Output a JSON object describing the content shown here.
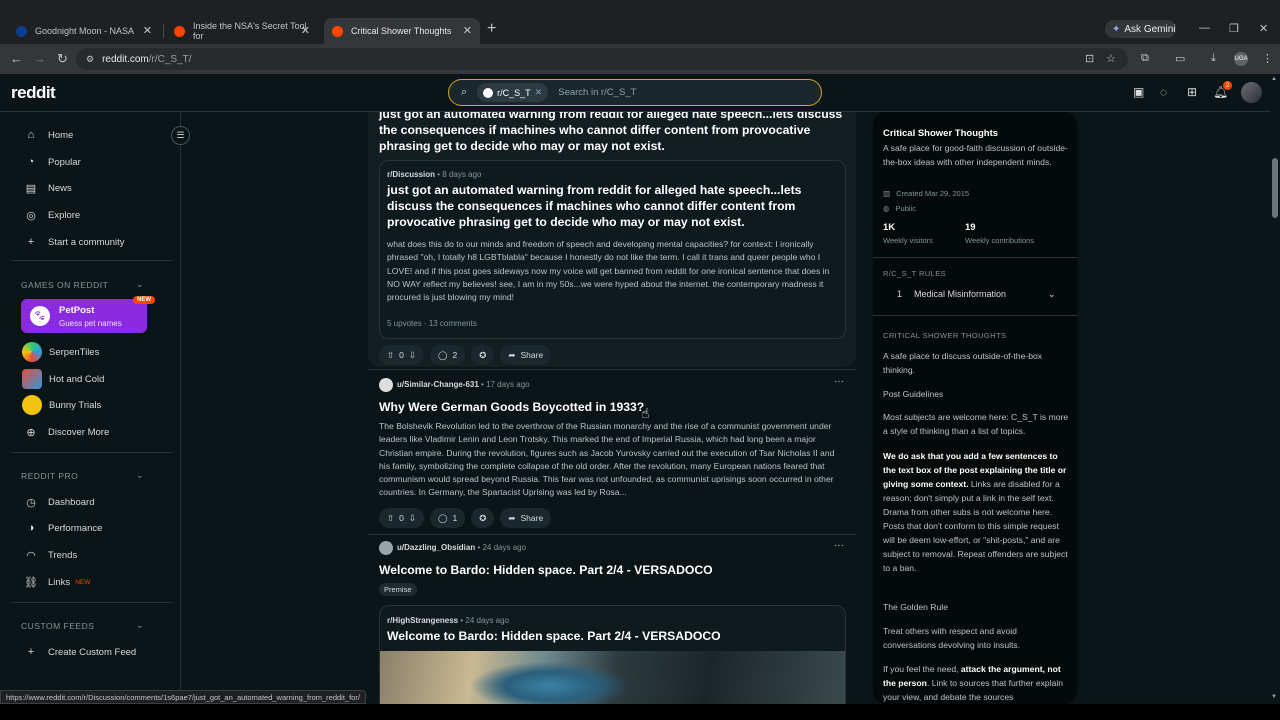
{
  "browser": {
    "tabs": [
      {
        "title": "Goodnight Moon - NASA",
        "favicon_color": "#0b3d91"
      },
      {
        "title": "Inside the NSA's Secret Tool for",
        "favicon_color": "#ff4500"
      },
      {
        "title": "Critical Shower Thoughts",
        "favicon_color": "#ff4500"
      }
    ],
    "gemini_label": "Ask Gemini",
    "url_host": "reddit.com",
    "url_path": "/r/C_S_T/",
    "profile_initials": "UGA",
    "status_url": "https://www.reddit.com/r/Discussion/comments/1s6pae7/just_got_an_automated_warning_from_reddit_for/"
  },
  "header": {
    "logo": "reddit",
    "search_chip": "r/C_S_T",
    "search_placeholder": "Search in r/C_S_T",
    "notification_count": "2"
  },
  "leftnav": {
    "items": [
      {
        "label": "Home",
        "icon": "home-icon"
      },
      {
        "label": "Popular",
        "icon": "popular-icon"
      },
      {
        "label": "News",
        "icon": "news-icon"
      },
      {
        "label": "Explore",
        "icon": "explore-icon"
      },
      {
        "label": "Start a community",
        "icon": "plus-icon"
      }
    ],
    "games_heading": "GAMES ON REDDIT",
    "petpost": {
      "title": "PetPost",
      "subtitle": "Guess pet names",
      "tag": "NEW"
    },
    "games": [
      {
        "label": "SerpenTiles",
        "color": "#2ecc71"
      },
      {
        "label": "Hot and Cold",
        "color": "#e74c3c"
      },
      {
        "label": "Bunny Trials",
        "color": "#f1c40f"
      },
      {
        "label": "Discover More",
        "color": ""
      }
    ],
    "pro_heading": "REDDIT PRO",
    "pro_items": [
      {
        "label": "Dashboard"
      },
      {
        "label": "Performance"
      },
      {
        "label": "Trends"
      },
      {
        "label": "Links",
        "tag": "NEW"
      }
    ],
    "custom_heading": "CUSTOM FEEDS",
    "create_feed": "Create Custom Feed"
  },
  "feed": {
    "post1": {
      "title": "just got an automated warning from reddit for alleged hate speech...lets discuss the consequences if machines who cannot differ content from provocative phrasing get to decide who may or may not exist.",
      "crosspost_sub": "r/Discussion",
      "crosspost_time": "8 days ago",
      "crosspost_title": "just got an automated warning from reddit for alleged hate speech...lets discuss the consequences if machines who cannot differ content from provocative phrasing get to decide who may or may not exist.",
      "crosspost_body": "what does this do to our minds and freedom of speech and developing mental capacities? for context: I ironically phrased \"oh, I totally h8 LGBTblabla\" because I honestly do not like the term. I call it trans and queer people who I LOVE! and if this post goes sideways now my voice will get banned from reddit for one ironical sentence that does in NO WAY reflect my believes! see, I am in my 50s...we were hyped about the internet. the contemporary madness it procured is just blowing my mind!",
      "crosspost_upvotes": "5 upvotes",
      "crosspost_comments": "13 comments",
      "votes": "0",
      "comments": "2",
      "share": "Share"
    },
    "post2": {
      "author": "u/Similar-Change-631",
      "time": "17 days ago",
      "title": "Why Were German Goods Boycotted in 1933?",
      "body": "The Bolshevik Revolution led to the overthrow of the Russian monarchy and the rise of a communist government under leaders like Vladimir Lenin and Leon Trotsky. This marked the end of Imperial Russia, which had long been a major Christian empire. During the revolution, figures such as Jacob Yurovsky carried out the execution of Tsar Nicholas II and his family, symbolizing the complete collapse of the old order. After the revolution, many European nations feared that communism would spread beyond Russia. This fear was not unfounded, as communist uprisings soon occurred in other countries. In Germany, the Spartacist Uprising was led by Rosa...",
      "votes": "0",
      "comments": "1",
      "share": "Share"
    },
    "post3": {
      "author": "u/Dazzling_Obsidian",
      "time": "24 days ago",
      "title": "Welcome to Bardo: Hidden space. Part 2/4 - VERSADOCO",
      "flair": "Premise",
      "crosspost_sub": "r/HighStrangeness",
      "crosspost_time": "24 days ago",
      "crosspost_title": "Welcome to Bardo: Hidden space. Part 2/4 - VERSADOCO"
    }
  },
  "sidebar": {
    "name": "Critical Shower Thoughts",
    "description": "A safe place for good-faith discussion of outside-the-box ideas with other independent minds.",
    "created": "Created Mar 29, 2015",
    "visibility": "Public",
    "visitors": "1K",
    "visitors_label": "Weekly visitors",
    "contributions": "19",
    "contributions_label": "Weekly contributions",
    "rules_heading": "R/C_S_T RULES",
    "rule1_num": "1",
    "rule1_label": "Medical Misinformation",
    "about_heading": "CRITICAL SHOWER THOUGHTS",
    "about_text": "A safe place to discuss outside-of-the-box thinking.",
    "guidelines_heading": "Post Guidelines",
    "guidelines_p1": "Most subjects are welcome here: C_S_T is more a style of thinking than a list of topics.",
    "guidelines_p2_bold": "We do ask that you add a few sentences to the text box of the post explaining the title or giving some context.",
    "guidelines_p2_rest": " Links are disabled for a reason; don't simply put a link in the self text. Drama from other subs is not welcome here. Posts that don't conform to this simple request will be deem low-effort, or \"shit-posts,\" and are subject to removal. Repeat offenders are subject to a ban.",
    "golden_rule": "The Golden Rule",
    "golden_text": "Treat others with respect and avoid conversations devolving into insults.",
    "need_pre": "If you feel the need, ",
    "need_bold": "attack the argument, not the person",
    "need_rest": ". Link to sources that further explain your view, and debate the sources"
  }
}
